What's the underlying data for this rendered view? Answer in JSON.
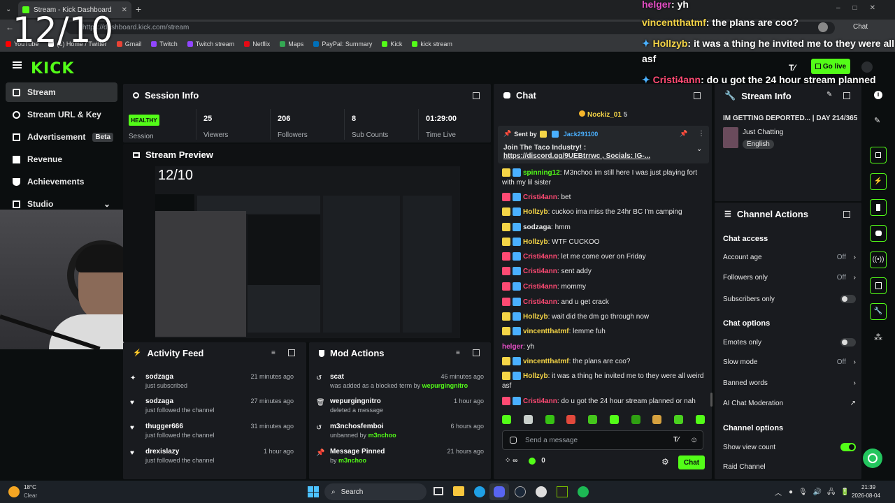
{
  "overlay_counter": "12/10",
  "browser": {
    "tab_title": "Stream - Kick Dashboard",
    "url": "https://dashboard.kick.com/stream",
    "chat_button": "Chat",
    "bookmarks": [
      "YouTube",
      "(1) Home / Twitter",
      "Gmail",
      "Twitch",
      "Twitch stream",
      "Netflix",
      "Maps",
      "PayPal: Summary",
      "Kick",
      "kick stream"
    ]
  },
  "header": {
    "logo": "KICK",
    "go_live": "Go live"
  },
  "sidebar": {
    "items": [
      {
        "label": "Stream"
      },
      {
        "label": "Stream URL & Key"
      },
      {
        "label": "Advertisement",
        "badge": "Beta"
      },
      {
        "label": "Revenue"
      },
      {
        "label": "Achievements"
      },
      {
        "label": "Studio"
      }
    ]
  },
  "session_info": {
    "title": "Session Info",
    "status": "HEALTHY",
    "status_label": "Session",
    "stats": [
      {
        "value": "25",
        "label": "Viewers"
      },
      {
        "value": "206",
        "label": "Followers"
      },
      {
        "value": "8",
        "label": "Sub Counts"
      },
      {
        "value": "01:29:00",
        "label": "Time Live"
      }
    ]
  },
  "stream_preview": {
    "title": "Stream Preview",
    "counter": "12/10"
  },
  "activity_feed": {
    "title": "Activity Feed",
    "items": [
      {
        "user": "sodzaga",
        "action": "just subscribed",
        "time": "21 minutes ago"
      },
      {
        "user": "sodzaga",
        "action": "just followed the channel",
        "time": "27 minutes ago"
      },
      {
        "user": "thugger666",
        "action": "just followed the channel",
        "time": "31 minutes ago"
      },
      {
        "user": "drexislazy",
        "action": "just followed the channel",
        "time": "1 hour ago"
      }
    ]
  },
  "mod_actions": {
    "title": "Mod Actions",
    "items": [
      {
        "title": "scat",
        "desc": "was added as a blocked term by",
        "by": "wepurgingnitro",
        "time": "46 minutes ago"
      },
      {
        "title": "wepurgingnitro",
        "desc": "deleted a message",
        "by": "",
        "time": "1 hour ago"
      },
      {
        "title": "m3nchosfemboi",
        "desc": "unbanned by",
        "by": "m3nchoo",
        "time": "6 hours ago"
      },
      {
        "title": "Message Pinned",
        "desc": "by",
        "by": "m3nchoo",
        "time": "21 hours ago"
      }
    ]
  },
  "chat": {
    "title": "Chat",
    "top_user": "Nockiz_01",
    "top_user_count": "5",
    "pinned_sent_by": "Sent by",
    "pinned_user": "Jack291100",
    "pinned_msg1": "Join The Taco Industry! :",
    "pinned_msg2": "https://discord.gg/9UEBtrrwc , Socials: IG-...",
    "messages": [
      {
        "user": "spinning12",
        "color": "#53fc18",
        "text": "M3nchoo im still here I was just playing fort with my lil sister"
      },
      {
        "user": "Cristi4ann",
        "color": "#ff4a73",
        "text": "bet"
      },
      {
        "user": "Hollzyb",
        "color": "#f5d547",
        "text": "cuckoo ima miss the 24hr BC I'm camping"
      },
      {
        "user": "sodzaga",
        "color": "#e8e8e8",
        "text": "hmm"
      },
      {
        "user": "Hollzyb",
        "color": "#f5d547",
        "text": "WTF CUCKOO"
      },
      {
        "user": "Cristi4ann",
        "color": "#ff4a73",
        "text": "let me come over on Friday"
      },
      {
        "user": "Cristi4ann",
        "color": "#ff4a73",
        "text": "sent addy"
      },
      {
        "user": "Cristi4ann",
        "color": "#ff4a73",
        "text": "mommy"
      },
      {
        "user": "Cristi4ann",
        "color": "#ff4a73",
        "text": "and u get crack"
      },
      {
        "user": "Hollzyb",
        "color": "#f5d547",
        "text": "wait did the dm go through now"
      },
      {
        "user": "vincentthatmf",
        "color": "#f5d547",
        "text": "lemme fuh"
      },
      {
        "user": "helger",
        "color": "#e34ec3",
        "text": "yh"
      },
      {
        "user": "vincentthatmf",
        "color": "#f5d547",
        "text": "the plans are coo?"
      },
      {
        "user": "Hollzyb",
        "color": "#f5d547",
        "text": "it was a thing he invited me to they were all weird asf"
      },
      {
        "user": "Cristi4ann",
        "color": "#ff4a73",
        "text": "do u got the 24 hour stream planned or nah"
      }
    ],
    "input_placeholder": "Send a message",
    "count": "0",
    "send_button": "Chat"
  },
  "stream_info": {
    "title": "Stream Info",
    "stream_title": "IM GETTING DEPORTED... | DAY 214/365",
    "category": "Just Chatting",
    "language": "English"
  },
  "channel_actions": {
    "title": "Channel Actions",
    "chat_access_head": "Chat access",
    "account_age": "Account age",
    "account_age_val": "Off",
    "followers_only": "Followers only",
    "followers_only_val": "Off",
    "subscribers_only": "Subscribers only",
    "chat_options_head": "Chat options",
    "emotes_only": "Emotes only",
    "slow_mode": "Slow mode",
    "slow_mode_val": "Off",
    "banned_words": "Banned words",
    "ai_moderation": "AI Chat Moderation",
    "channel_options_head": "Channel options",
    "show_view_count": "Show view count",
    "raid_channel": "Raid Channel"
  },
  "overlay_chat": [
    {
      "user": "helger",
      "color": "#e34ec3",
      "text": "yh"
    },
    {
      "user": "vincentthatmf",
      "color": "#f5d547",
      "text": "the plans are coo?"
    },
    {
      "user": "Hollzyb",
      "color": "#f5d547",
      "text": "it was a thing he invited me to they were all weird"
    },
    {
      "user": "",
      "color": "#fff",
      "text": "asf"
    },
    {
      "user": "Cristi4ann",
      "color": "#ff4a73",
      "text": "do u got the 24 hour stream planned"
    }
  ],
  "taskbar": {
    "weather_temp": "18°C",
    "weather_desc": "Clear",
    "search": "Search",
    "time": "21:39",
    "date": "2026-08-04"
  }
}
